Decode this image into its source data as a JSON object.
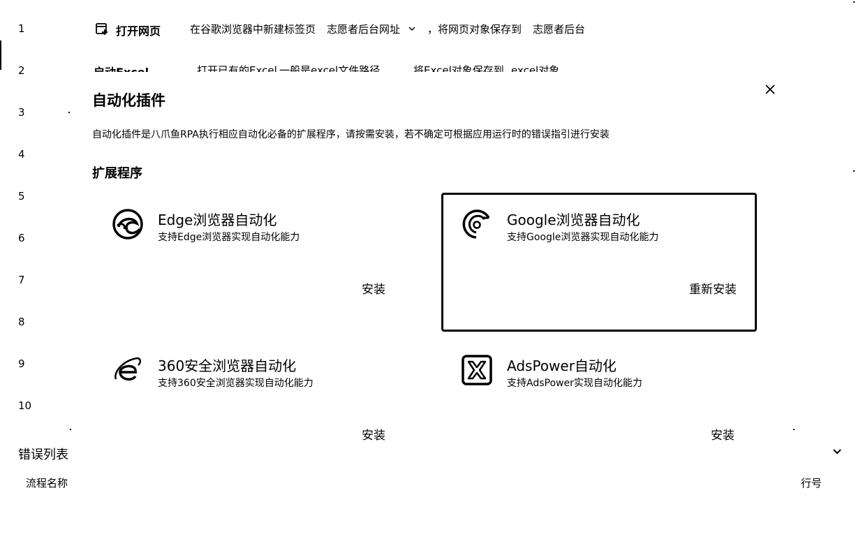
{
  "editor": {
    "line_numbers": [
      "1",
      "2",
      "3",
      "4",
      "5",
      "6",
      "7",
      "8",
      "9",
      "10"
    ],
    "row1": {
      "command": "打开网页",
      "text1": "在谷歌浏览器中新建标签页",
      "param": "志愿者后台网址",
      "text2": "，将网页对象保存到",
      "target": "志愿者后台"
    },
    "row2": {
      "command": "启动Excel",
      "text1": "打开已有的Excel",
      "param": "一般是excel文件路径",
      "text2": "将Excel对象保存到",
      "target": "excel对象"
    }
  },
  "modal": {
    "title": "自动化插件",
    "description": "自动化插件是八爪鱼RPA执行相应自动化必备的扩展程序，请按需安装，若不确定可根据应用运行时的错误指引进行安装",
    "section_title": "扩展程序",
    "close_icon": "close-icon",
    "extensions": [
      {
        "name": "Edge浏览器自动化",
        "desc": "支持Edge浏览器实现自动化能力",
        "action": "安装",
        "icon": "edge-icon"
      },
      {
        "name": "Google浏览器自动化",
        "desc": "支持Google浏览器实现自动化能力",
        "action": "重新安装",
        "icon": "chrome-icon"
      },
      {
        "name": "360安全浏览器自动化",
        "desc": "支持360安全浏览器实现自动化能力",
        "action": "安装",
        "icon": "ie-360-icon"
      },
      {
        "name": "AdsPower自动化",
        "desc": "支持AdsPower实现自动化能力",
        "action": "安装",
        "icon": "adspower-icon"
      }
    ]
  },
  "error_panel": {
    "title": "错误列表",
    "columns": [
      "流程名称",
      "行号"
    ]
  }
}
